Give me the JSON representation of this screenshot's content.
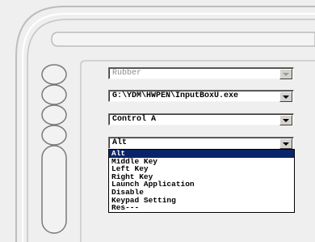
{
  "combos": [
    {
      "value": "Rubber",
      "state": "disabled"
    },
    {
      "value": "G:\\YDM\\HWPEN\\InputBoxU.exe",
      "state": "enabled"
    },
    {
      "value": "Control A",
      "state": "enabled"
    },
    {
      "value": "Alt",
      "state": "enabled",
      "expanded": true
    }
  ],
  "dropdown": {
    "selected": "Alt",
    "options": [
      "Alt",
      "Middle Key",
      "Left Key",
      "Right Key",
      "Launch Application",
      "Disable",
      "Keypad Setting",
      "Res---"
    ]
  }
}
